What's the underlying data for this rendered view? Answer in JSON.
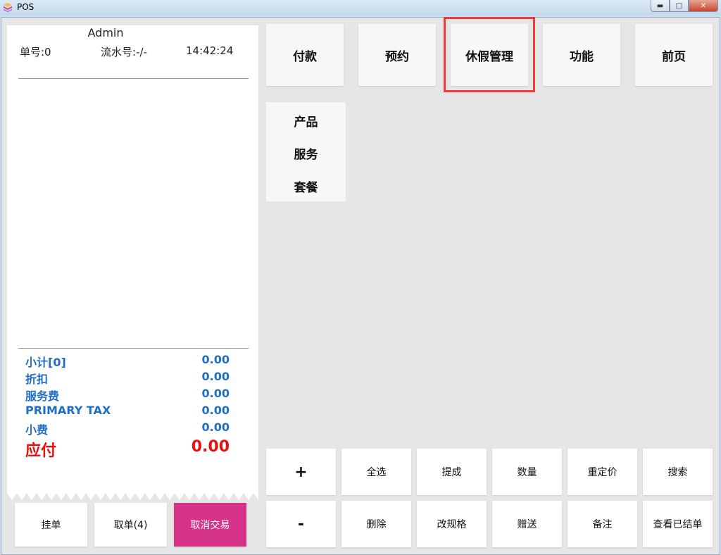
{
  "window": {
    "title": "POS"
  },
  "receipt": {
    "user": "Admin",
    "order_no": "单号:0",
    "serial_no": "流水号:-/-",
    "time": "14:42:24",
    "summary": [
      {
        "label": "小计[0]",
        "value": "0.00"
      },
      {
        "label": "折扣",
        "value": "0.00"
      },
      {
        "label": "服务费",
        "value": "0.00"
      },
      {
        "label": "PRIMARY TAX",
        "value": "0.00"
      },
      {
        "label": "小费",
        "value": "0.00"
      }
    ],
    "total": {
      "label": "应付",
      "value": "0.00"
    },
    "colors": {
      "summary": "#1f6fc5",
      "total": "#e81010"
    }
  },
  "bottom_actions": {
    "hold": "挂单",
    "retrieve": "取单(4)",
    "cancel": "取消交易"
  },
  "top_menu": [
    "付款",
    "预约",
    "休假管理",
    "功能",
    "前页"
  ],
  "highlighted_menu": "休假管理",
  "categories": [
    "产品",
    "服务",
    "套餐"
  ],
  "operations": {
    "row1": [
      "+",
      "全选",
      "提成",
      "数量",
      "重定价",
      "搜索"
    ],
    "row2": [
      "-",
      "删除",
      "改规格",
      "赠送",
      "备注",
      "查看已结单"
    ]
  },
  "accent_colors": {
    "cancel_button": "#d6338a",
    "highlight_box": "#ef3b3b"
  }
}
